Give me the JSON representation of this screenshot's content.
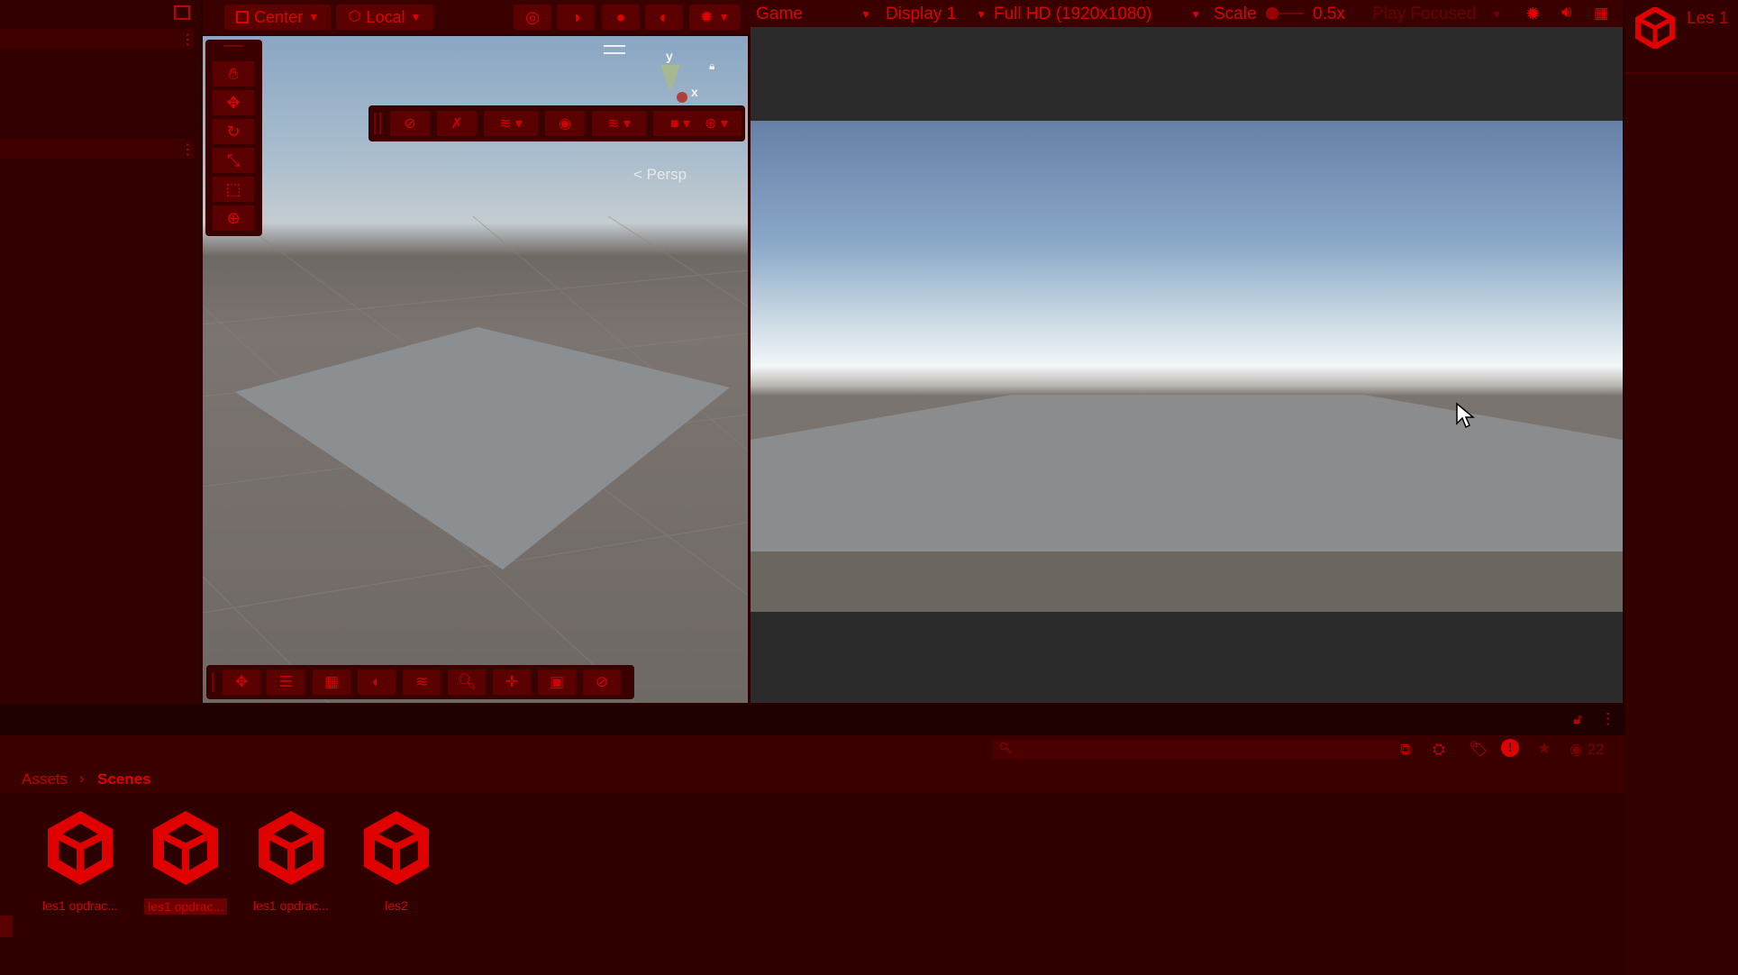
{
  "toolbar": {
    "pivot_mode": "Center",
    "pivot_rotation": "Local"
  },
  "game_toolbar": {
    "tab": "Game",
    "display": "Display 1",
    "resolution": "Full HD (1920x1080)",
    "scale_label": "Scale",
    "scale_value": "0.5x",
    "play_mode": "Play Focused"
  },
  "scene": {
    "projection_label": "Persp",
    "gizmo_y": "y",
    "gizmo_x": "x"
  },
  "right_panel": {
    "title": "Les 1"
  },
  "project": {
    "breadcrumb": [
      "Assets",
      "Scenes"
    ],
    "search_placeholder": "",
    "visible_count": "22",
    "assets": [
      {
        "label": "les1 opdrac...",
        "selected": false
      },
      {
        "label": "les1 opdrac...",
        "selected": true
      },
      {
        "label": "les1 opdrac...",
        "selected": false
      },
      {
        "label": "les2",
        "selected": false
      }
    ]
  },
  "colors": {
    "accent": "#e00000",
    "panel": "#330000",
    "toolbar": "#3a0000",
    "button": "#5a0000"
  }
}
